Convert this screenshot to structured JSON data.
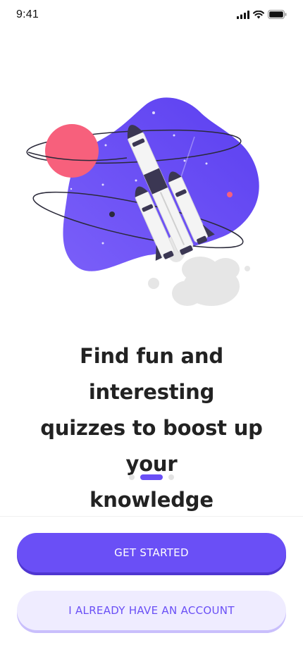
{
  "status_bar": {
    "time": "9:41",
    "icons": [
      "signal-icon",
      "wifi-icon",
      "battery-icon"
    ]
  },
  "hero": {
    "illustration": "rocket-launch-illustration",
    "colors": {
      "blob": "#6a4ff6",
      "planet": "#f7607c",
      "smoke": "#e6e6e6",
      "rocket_dark": "#3b3753",
      "rocket_light": "#f4f4f4"
    }
  },
  "headline": {
    "line1": "Find fun and interesting",
    "line2": "quizzes to boost up your",
    "line3": "knowledge"
  },
  "pager": {
    "count": 3,
    "active_index": 1
  },
  "actions": {
    "primary_label": "GET STARTED",
    "secondary_label": "I ALREADY HAVE AN ACCOUNT"
  },
  "theme": {
    "accent": "#6a4ff6",
    "accent_soft": "#efecff"
  }
}
